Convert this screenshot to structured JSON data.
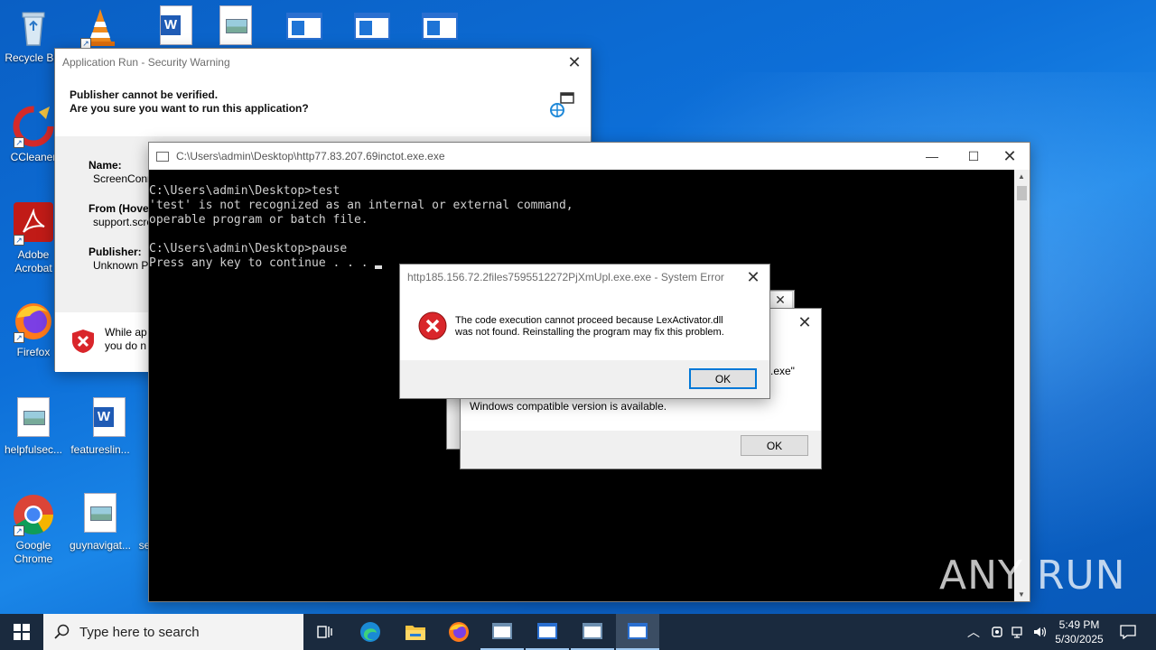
{
  "desktop": {
    "icons": [
      {
        "label": "Recycle Bin"
      },
      {
        "label": "CCleaner"
      },
      {
        "label": "Adobe Acrobat"
      },
      {
        "label": "Firefox"
      },
      {
        "label": "helpfulsec..."
      },
      {
        "label": "featureslin..."
      },
      {
        "label": "Google Chrome"
      },
      {
        "label": "guynavigat..."
      },
      {
        "label": "se"
      }
    ]
  },
  "security_warning": {
    "title": "Application Run - Security Warning",
    "heading1": "Publisher cannot be verified.",
    "heading2": "Are you sure you want to run this application?",
    "name_label": "Name:",
    "name_value": "ScreenConn",
    "from_label": "From (Hove",
    "from_value": "support.scre",
    "publisher_label": "Publisher:",
    "publisher_value": "Unknown P",
    "warning_line1": "While ap",
    "warning_line2": "you do n"
  },
  "cmd": {
    "title": "C:\\Users\\admin\\Desktop\\http77.83.207.69inctot.exe.exe",
    "lines": [
      "C:\\Users\\admin\\Desktop>test",
      "'test' is not recognized as an internal or external command,",
      "operable program or batch file.",
      "",
      "C:\\Users\\admin\\Desktop>pause",
      "Press any key to continue . . . "
    ]
  },
  "back_dialog": {
    "partial_text": ".exe\"",
    "message": "Windows compatible version is available.",
    "ok_label": "OK"
  },
  "system_error": {
    "title": "http185.156.72.2files7595512272PjXmUpl.exe.exe - System Error",
    "message_line1": "The code execution cannot proceed because LexActivator.dll",
    "message_line2": "was not found. Reinstalling the program may fix this problem.",
    "ok_label": "OK"
  },
  "taskbar": {
    "search_placeholder": "Type here to search",
    "time": "5:49 PM",
    "date": "5/30/2025"
  },
  "watermark": "ANY RUN",
  "colors": {
    "desktop": "#0d6fd8",
    "taskbar": "#1a2a3e",
    "accent": "#0078d7",
    "error_red": "#d9262b"
  }
}
